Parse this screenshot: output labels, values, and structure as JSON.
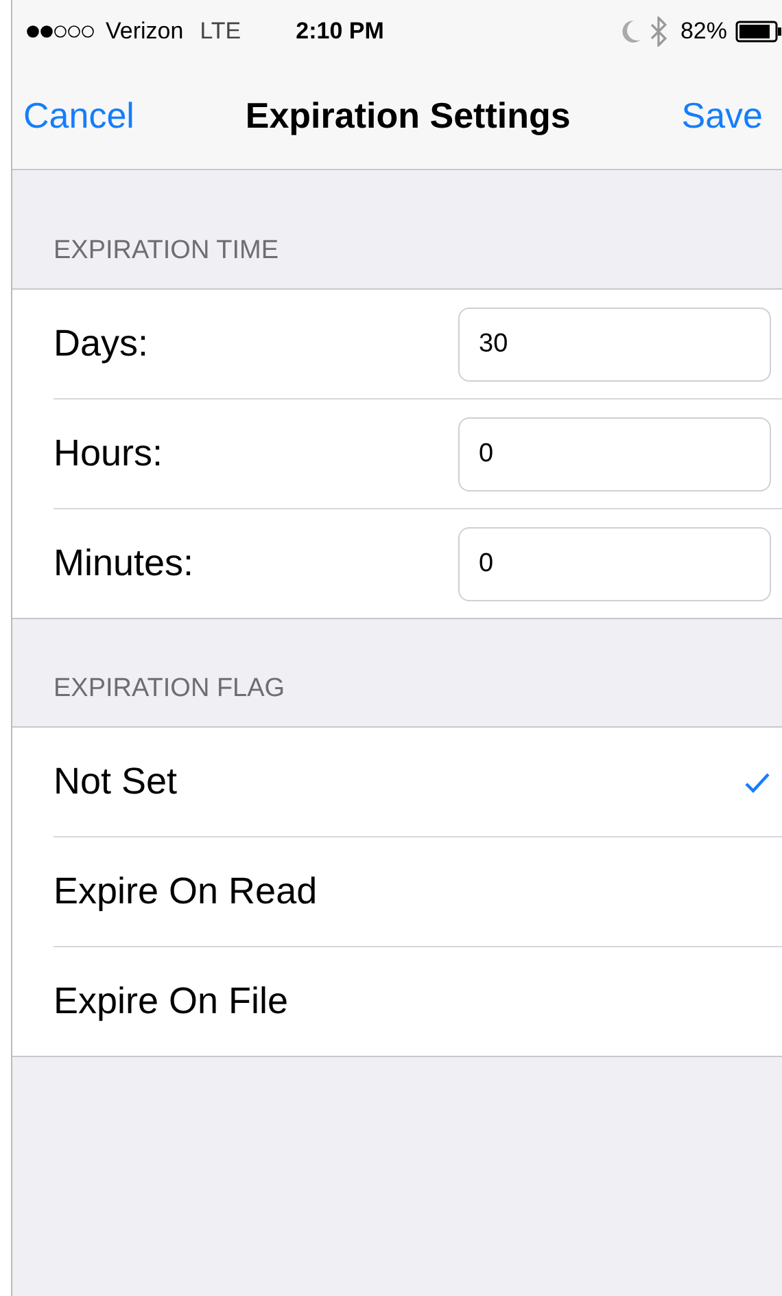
{
  "status_bar": {
    "carrier": "Verizon",
    "network": "LTE",
    "time": "2:10 PM",
    "battery": "82%"
  },
  "nav_bar": {
    "left": "Cancel",
    "title": "Expiration Settings",
    "right": "Save"
  },
  "expiration_time": {
    "header": "EXPIRATION TIME",
    "fields": [
      {
        "label": "Days:",
        "value": "30"
      },
      {
        "label": "Hours:",
        "value": "0"
      },
      {
        "label": "Minutes:",
        "value": "0"
      }
    ]
  },
  "expiration_flag": {
    "header": "EXPIRATION FLAG",
    "options": [
      {
        "label": "Not Set",
        "selected": true
      },
      {
        "label": "Expire On Read",
        "selected": false
      },
      {
        "label": "Expire On File",
        "selected": false
      }
    ]
  }
}
